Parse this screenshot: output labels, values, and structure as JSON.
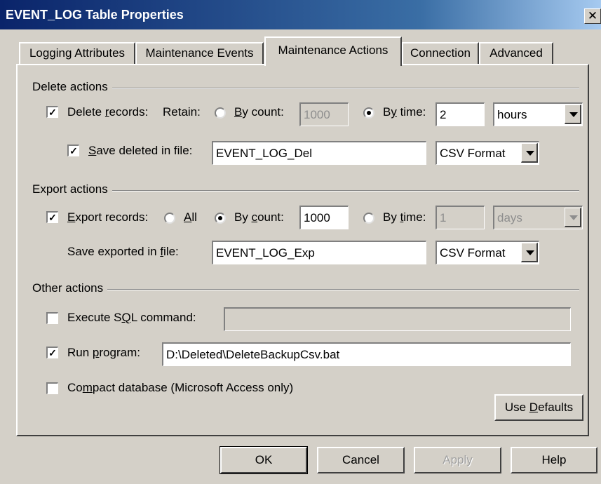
{
  "window": {
    "title": "EVENT_LOG Table Properties",
    "close_glyph": "✕"
  },
  "tabs": [
    "Logging Attributes",
    "Maintenance Events",
    "Maintenance Actions",
    "Connection",
    "Advanced"
  ],
  "active_tab": "Maintenance Actions",
  "delete_actions": {
    "group_label": "Delete actions",
    "delete_records": {
      "checked": true,
      "label": "Delete records:"
    },
    "retain_label": "Retain:",
    "by_count": {
      "selected": false,
      "label": "By count:",
      "value": "1000"
    },
    "by_time": {
      "selected": true,
      "label": "By time:",
      "value": "2",
      "unit": "hours"
    },
    "save_deleted": {
      "checked": true,
      "label": "Save deleted in file:",
      "file": "EVENT_LOG_Del",
      "format": "CSV Format"
    }
  },
  "export_actions": {
    "group_label": "Export actions",
    "export_records": {
      "checked": true,
      "label": "Export records:"
    },
    "all": {
      "selected": false,
      "label": "All"
    },
    "by_count": {
      "selected": true,
      "label": "By count:",
      "value": "1000"
    },
    "by_time": {
      "selected": false,
      "label": "By time:",
      "value": "1",
      "unit": "days"
    },
    "save_exported": {
      "label": "Save exported in file:",
      "file": "EVENT_LOG_Exp",
      "format": "CSV Format"
    }
  },
  "other_actions": {
    "group_label": "Other actions",
    "execute_sql": {
      "checked": false,
      "label": "Execute SQL command:",
      "value": ""
    },
    "run_program": {
      "checked": true,
      "label": "Run program:",
      "value": "D:\\Deleted\\DeleteBackupCsv.bat"
    },
    "compact_db": {
      "checked": false,
      "label": "Compact database (Microsoft Access only)"
    }
  },
  "buttons": {
    "use_defaults": "Use Defaults",
    "ok": "OK",
    "cancel": "Cancel",
    "apply": "Apply",
    "help": "Help"
  },
  "check_glyph": "✓"
}
